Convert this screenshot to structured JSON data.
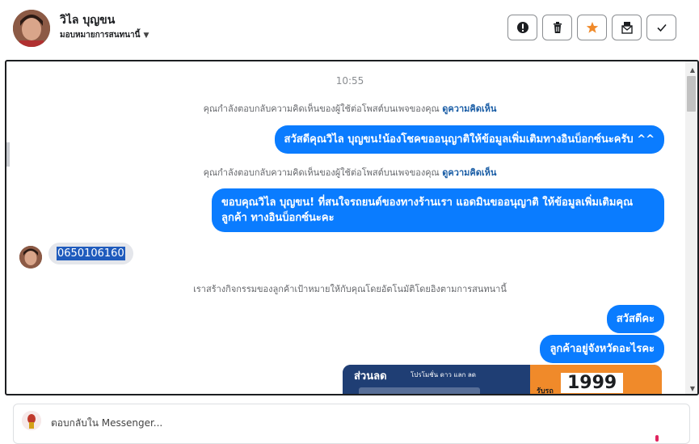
{
  "header": {
    "name": "วิไล บุญขน",
    "assign_label": "มอบหมายการสนทนานี้",
    "actions": [
      "alert-icon",
      "trash-icon",
      "star-icon",
      "mark-unread-icon",
      "check-icon"
    ],
    "star_color": "#f08a2a"
  },
  "chat": {
    "time": "10:55",
    "messages": [
      {
        "type": "system",
        "text": "คุณกำลังตอบกลับความคิดเห็นของผู้ใช้ต่อโพสต์บนเพจของคุณ",
        "link": "ดูความคิดเห็น"
      },
      {
        "type": "out",
        "text": "สวัสดีคุณวิไล บุญขน!น้องโชคขออนุญาติให้ข้อมูลเพิ่มเติมทางอินบ็อกซ์นะครับ ^^"
      },
      {
        "type": "system",
        "text": "คุณกำลังตอบกลับความคิดเห็นของผู้ใช้ต่อโพสต์บนเพจของคุณ",
        "link": "ดูความคิดเห็น"
      },
      {
        "type": "out",
        "text": "ขอบคุณวิไล บุญขน! ที่สนใจรถยนต์ของทางร้านเรา แอดมินขออนุญาติ ให้ข้อมูลเพิ่มเติมคุณลูกค้า ทางอินบ็อกซ์นะคะ"
      },
      {
        "type": "in",
        "text": "0650106160"
      },
      {
        "type": "system",
        "text": "เราสร้างกิจกรรมของลูกค้าเป้าหมายให้กับคุณโดยอัตโนมัติโดยอิงตามการสนทนานี้"
      },
      {
        "type": "out",
        "text": "สวัสดีคะ"
      },
      {
        "type": "out",
        "text": "ลูกค้าอยู่จังหวัดอะไรคะ"
      }
    ],
    "promo": {
      "headline": "ส่วนลด",
      "subline": "โปรโมชั่น ดาว แลก ลด",
      "right_label": "รับรถ",
      "price": "1999"
    },
    "accent": "#0a7cff"
  },
  "composer": {
    "placeholder": "ตอบกลับใน Messenger..."
  }
}
